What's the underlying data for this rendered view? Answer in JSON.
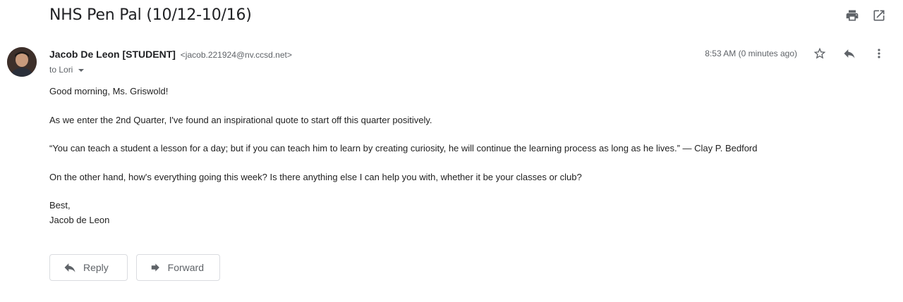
{
  "subject": "NHS Pen Pal (10/12-10/16)",
  "top_actions": [
    {
      "name": "print-icon"
    },
    {
      "name": "open-in-new-window-icon"
    }
  ],
  "message": {
    "sender_name": "Jacob De Leon [STUDENT]",
    "sender_email": "<jacob.221924@nv.ccsd.net>",
    "to_label": "to Lori",
    "timestamp": "8:53 AM (0 minutes ago)",
    "actions": [
      "star-icon",
      "reply-icon",
      "more-vert-icon"
    ],
    "body": {
      "greeting": "Good morning, Ms. Griswold!",
      "p1": "As we enter the 2nd Quarter, I've found an inspirational quote to start off this quarter positively.",
      "quote": " “You can teach a student a lesson for a day; but if you can teach him to learn by creating curiosity, he will continue the learning process as long as he lives.” — Clay P. Bedford",
      "p2": "On the other hand, how's everything going this week? Is there anything else I can help you with, whether it be your classes or club?",
      "signoff": "Best,",
      "signature": "Jacob de Leon"
    }
  },
  "reply_actions": {
    "reply_label": "Reply",
    "forward_label": "Forward"
  },
  "colors": {
    "text": "#222222",
    "secondary": "#5f6368",
    "border": "#dadce0"
  }
}
